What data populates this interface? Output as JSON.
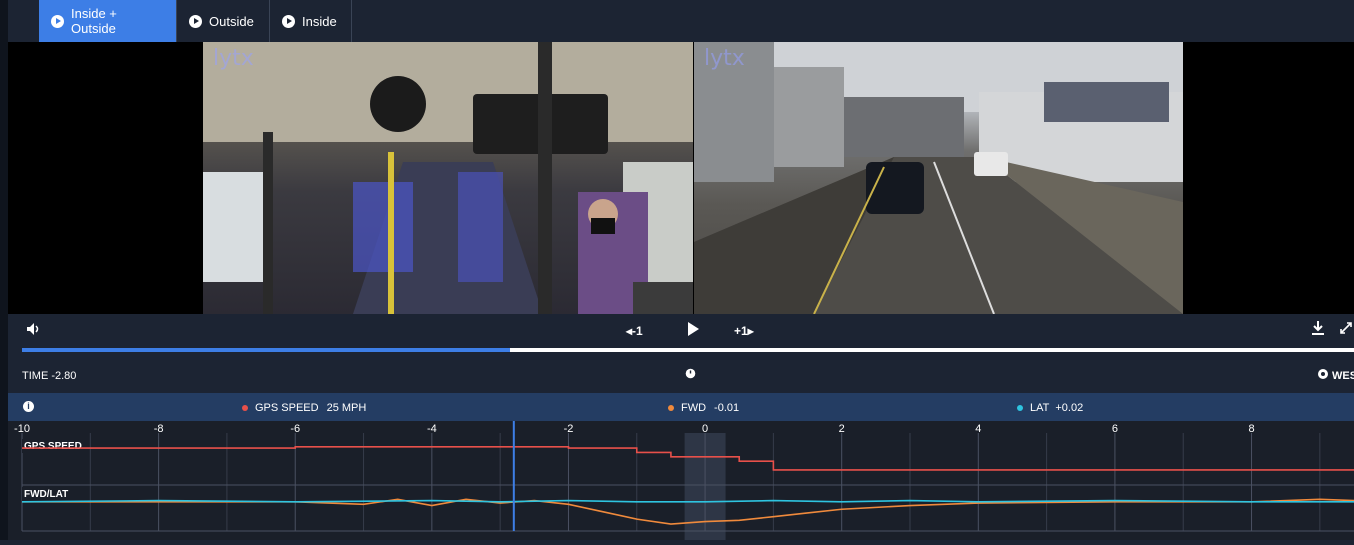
{
  "tabs": [
    {
      "label": "Inside + Outside",
      "active": true
    },
    {
      "label": "Outside",
      "active": false
    },
    {
      "label": "Inside",
      "active": false
    }
  ],
  "video": {
    "watermark": "lytx"
  },
  "controls": {
    "volume_icon": "speaker-icon",
    "step_back_label": "◂-1",
    "play_icon": "play-icon",
    "step_forward_label": "+1▸",
    "download_icon": "download-icon",
    "expand_icon": "expand-icon",
    "progress": 0.366
  },
  "timeline": {
    "time_label": "TIME -2.80",
    "clock_icon": "stopwatch-icon",
    "heading_label": "WES"
  },
  "metrics": {
    "info_icon": "info-icon",
    "gps_speed_label": "GPS SPEED",
    "gps_speed_value": "25 MPH",
    "fwd_label": "FWD",
    "fwd_value": "-0.01",
    "lat_label": "LAT",
    "lat_value": "+0.02",
    "colors": {
      "gps": "#e8504a",
      "fwd": "#f08a3c",
      "lat": "#2ec4e0"
    }
  },
  "chart_data": {
    "type": "line",
    "xlim": [
      -10,
      9.5
    ],
    "xticks": [
      -10,
      -8,
      -6,
      -4,
      -2,
      0,
      2,
      4,
      6,
      8
    ],
    "cursor_x": -2.8,
    "highlight_x": [
      -0.3,
      0.3
    ],
    "panels": [
      {
        "label": "GPS SPEED",
        "series": [
          {
            "name": "GPS SPEED",
            "color": "#e8504a",
            "x": [
              -10,
              -6,
              -6,
              -2,
              -2,
              -1,
              -1,
              -0.5,
              -0.5,
              0.5,
              0.5,
              1,
              1,
              9.5
            ],
            "y": [
              25,
              25,
              25.3,
              25.3,
              25,
              25,
              24,
              24,
              23,
              23,
              22,
              22,
              20,
              20
            ]
          }
        ]
      },
      {
        "label": "FWD/LAT",
        "series": [
          {
            "name": "FWD",
            "color": "#f08a3c",
            "x": [
              -10,
              -8,
              -6,
              -5,
              -4.5,
              -4,
              -3.5,
              -3,
              -2.5,
              -2,
              -1.5,
              -1,
              -0.5,
              0,
              0.5,
              1,
              1.5,
              2,
              3,
              4,
              6,
              8,
              9,
              9.5
            ],
            "y": [
              0,
              0,
              0,
              -0.02,
              0.02,
              -0.03,
              0.02,
              -0.01,
              0.01,
              -0.02,
              -0.08,
              -0.14,
              -0.18,
              -0.16,
              -0.15,
              -0.12,
              -0.09,
              -0.06,
              -0.03,
              -0.01,
              0,
              0,
              0.02,
              0.01
            ]
          },
          {
            "name": "LAT",
            "color": "#2ec4e0",
            "x": [
              -10,
              -8,
              -6,
              -4,
              -3,
              -2,
              -1,
              0,
              1,
              2,
              3,
              4,
              6,
              8,
              9,
              9.5
            ],
            "y": [
              0,
              0.01,
              0,
              0.01,
              0,
              0.01,
              0,
              0,
              0.01,
              0,
              0.01,
              0,
              0.01,
              0,
              0,
              0
            ]
          }
        ]
      }
    ]
  }
}
